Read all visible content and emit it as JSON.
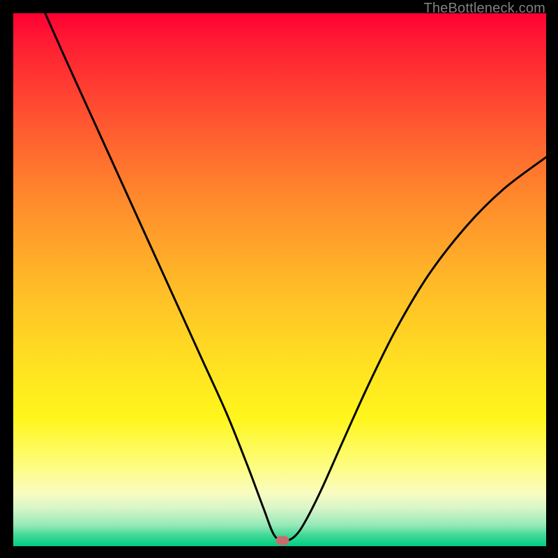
{
  "watermark": "TheBottleneck.com",
  "marker": {
    "x_pct": 50.5,
    "y_pct": 98.9
  },
  "chart_data": {
    "type": "line",
    "title": "",
    "xlabel": "",
    "ylabel": "",
    "xlim": [
      0,
      100
    ],
    "ylim": [
      0,
      100
    ],
    "grid": false,
    "series": [
      {
        "name": "bottleneck-curve",
        "x": [
          6,
          10,
          15,
          20,
          25,
          30,
          35,
          40,
          44,
          47,
          49,
          51,
          53,
          55,
          58,
          62,
          67,
          72,
          78,
          85,
          92,
          100
        ],
        "y": [
          100,
          91,
          80,
          69,
          58,
          47,
          36,
          25,
          15,
          7,
          2,
          1,
          2,
          5,
          11,
          20,
          31,
          41,
          51,
          60,
          67,
          73
        ]
      }
    ],
    "annotations": [
      {
        "type": "marker",
        "x": 50.5,
        "y": 1.1,
        "label": "optimal-point"
      }
    ],
    "background_gradient": {
      "stops": [
        {
          "pct": 0,
          "color": "#ff0033"
        },
        {
          "pct": 35,
          "color": "#ff8a2c"
        },
        {
          "pct": 65,
          "color": "#ffdf22"
        },
        {
          "pct": 90,
          "color": "#f9fcc0"
        },
        {
          "pct": 100,
          "color": "#00cf83"
        }
      ]
    }
  }
}
